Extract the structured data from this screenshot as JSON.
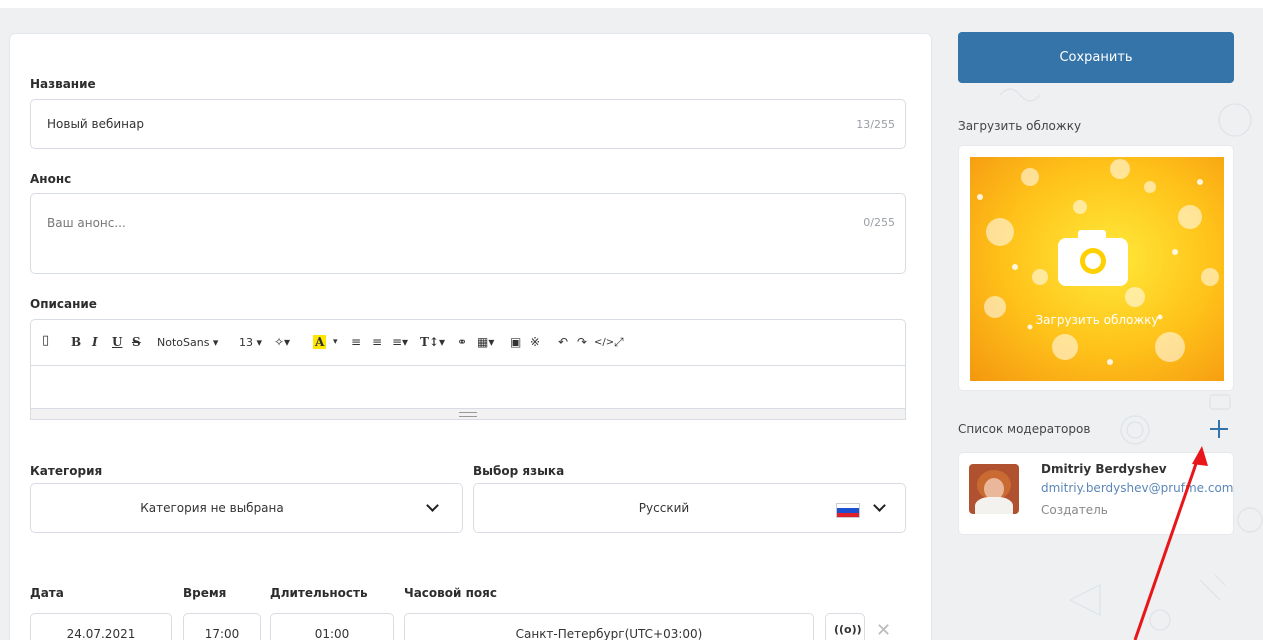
{
  "form": {
    "title_label": "Название",
    "title_value": "Новый вебинар",
    "title_counter": "13/255",
    "announce_label": "Анонс",
    "announce_placeholder": "Ваш анонс...",
    "announce_counter": "0/255",
    "description_label": "Описание",
    "toolbar": {
      "font": "NotoSans ▾",
      "size": "13 ▾"
    },
    "category_label": "Категория",
    "category_value": "Категория не выбрана",
    "language_label": "Выбор языка",
    "language_value": "Русский",
    "date_label": "Дата",
    "date_value": "24.07.2021",
    "time_label": "Время",
    "time_value": "17:00",
    "duration_label": "Длительность",
    "duration_value": "01:00",
    "timezone_label": "Часовой пояс",
    "timezone_value": "Санкт-Петербург(UTC+03:00)"
  },
  "sidebar": {
    "save_label": "Сохранить",
    "cover_label": "Загрузить обложку",
    "cover_overlay": "Загрузить обложку",
    "moderators_label": "Список модераторов",
    "moderator": {
      "name": "Dmitriy Berdyshev",
      "email": "dmitriy.berdyshev@prufme.com",
      "role": "Создатель"
    }
  },
  "colors": {
    "accent": "#3574a8",
    "arrow": "#e8161a"
  }
}
